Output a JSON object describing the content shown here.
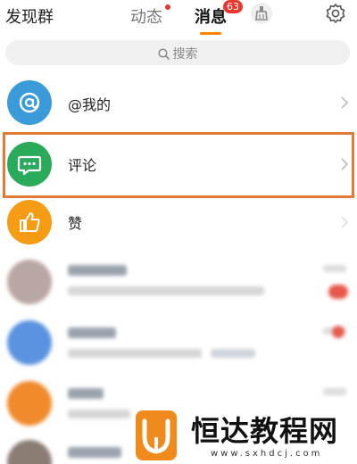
{
  "header": {
    "discover": "发现群",
    "tabs": [
      {
        "label": "动态",
        "has_dot": true
      },
      {
        "label": "消息",
        "active": true
      }
    ],
    "badge_count": "63"
  },
  "search": {
    "placeholder": "搜索"
  },
  "rows": [
    {
      "label": "@我的",
      "icon": "at-icon",
      "color": "#3a9bd8"
    },
    {
      "label": "评论",
      "icon": "comment-icon",
      "color": "#2aaa5b",
      "highlighted": true
    },
    {
      "label": "赞",
      "icon": "thumbs-up-icon",
      "color": "#f59b14"
    }
  ],
  "watermark": {
    "title": "恒达教程网",
    "url": "www.sxhdcj.com"
  },
  "colors": {
    "accent": "#ff8200",
    "badge": "#e8382f",
    "highlight_border": "#e07a35"
  }
}
